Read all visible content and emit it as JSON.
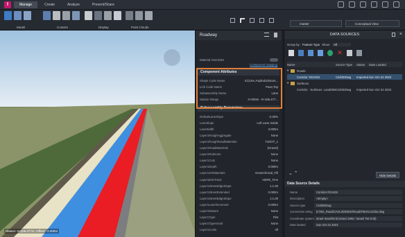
{
  "app": {
    "logo": "I"
  },
  "tabs": [
    "Manage",
    "Create",
    "Analyze",
    "Present/Share"
  ],
  "ribbon": {
    "groups": [
      "Model",
      "Content",
      "Display",
      "Point Clouds"
    ]
  },
  "toolbar": {
    "branch": "master",
    "view_mode": "Conceptual View"
  },
  "props": {
    "title": "Roadway",
    "material_overrides": "Material Overrides",
    "component_mapping": "Component mapping",
    "attributes_header": "Component Attributes",
    "attributes": [
      {
        "k": "Shape Code Name",
        "v": "IC(USA,Asphalt,Distom..."
      },
      {
        "k": "Link Code Name",
        "v": "Pave;Top"
      },
      {
        "k": "Subassembly Name",
        "v": "Lane"
      },
      {
        "k": "Station Range",
        "v": "0+000m - 0+106.477..."
      }
    ],
    "params_header": "Subassembly Parameters",
    "params": [
      {
        "k": "DefaultLaneSlope",
        "v": "-2.00%"
      },
      {
        "k": "LaneSlope",
        "v": "Left Lane Inside"
      },
      {
        "k": "LaneWidth",
        "v": "3.000m"
      },
      {
        "k": "Layer1RoughAggregate",
        "v": "None"
      },
      {
        "k": "Layer1RoughRoadMaterials",
        "v": "TxDOT_1"
      },
      {
        "k": "Layer1RoadMaterials",
        "v": "(Gravel)"
      },
      {
        "k": "Layer1Rulerons",
        "v": "None"
      },
      {
        "k": "Layer1Cuts",
        "v": "None"
      },
      {
        "k": "Layer1Depth",
        "v": "0.000m"
      },
      {
        "k": "Layer1SHMaterials",
        "v": "Geotechnical_Fill"
      },
      {
        "k": "Layer1EntrTrack",
        "v": "HDPE_Fine"
      },
      {
        "k": "Layer1StreetEdgeSlope",
        "v": "1:1.00"
      },
      {
        "k": "Layer1StreetExtended",
        "v": "0.000m"
      },
      {
        "k": "Layer1StreetEdgeSlope",
        "v": "1:1.00"
      },
      {
        "k": "Layer1Lanelncrement",
        "v": "0.000m"
      },
      {
        "k": "Layer1Mixture",
        "v": "None"
      },
      {
        "k": "Layer1Type",
        "v": "Flat"
      },
      {
        "k": "Layer1TypesVoid",
        "v": "None"
      },
      {
        "k": "Layer1Costs",
        "v": "All"
      }
    ]
  },
  "datasources": {
    "title": "DATA SOURCES",
    "group_by": "Group by:",
    "group_value": "Feature Type",
    "show": "Show:",
    "show_value": "All",
    "cols": [
      "Name",
      "Source Type",
      "Status",
      "Date Loaded"
    ],
    "groups": [
      {
        "name": "Roads",
        "item": {
          "name": "Corridor: ROADS",
          "type": "Civil3DDwg",
          "status": "Imported",
          "date": "Sun Oct 22 2023"
        }
      },
      {
        "name": "Surfaces",
        "item": {
          "name": "Corridor - Surfaces: Land0000...",
          "type": "Civil3DDwg",
          "status": "Imported",
          "date": "Sun Oct 22 2023"
        }
      }
    ],
    "hide_details": "Hide Details",
    "details_title": "Data Source Details",
    "details": [
      {
        "k": "Name",
        "v": "Corridor ROADS"
      },
      {
        "k": "Description",
        "v": "<Empty>"
      },
      {
        "k": "Source type",
        "v": "Civil3DDwg"
      },
      {
        "k": "Connection string",
        "v": "D:\\RD_Road\\CIVIL3D\\DWG\\Road\\Files\\Corridor.dwg"
      },
      {
        "k": "Coordinate system",
        "v": "Israel-Israel\\Grid (Israel 1993 / Israeli TM Grid)"
      },
      {
        "k": "Date loaded",
        "v": "Sun Oct 22 2023"
      }
    ]
  },
  "viewport": {
    "coords": "Station: 0+106.477m; Offset: -2.000m"
  }
}
